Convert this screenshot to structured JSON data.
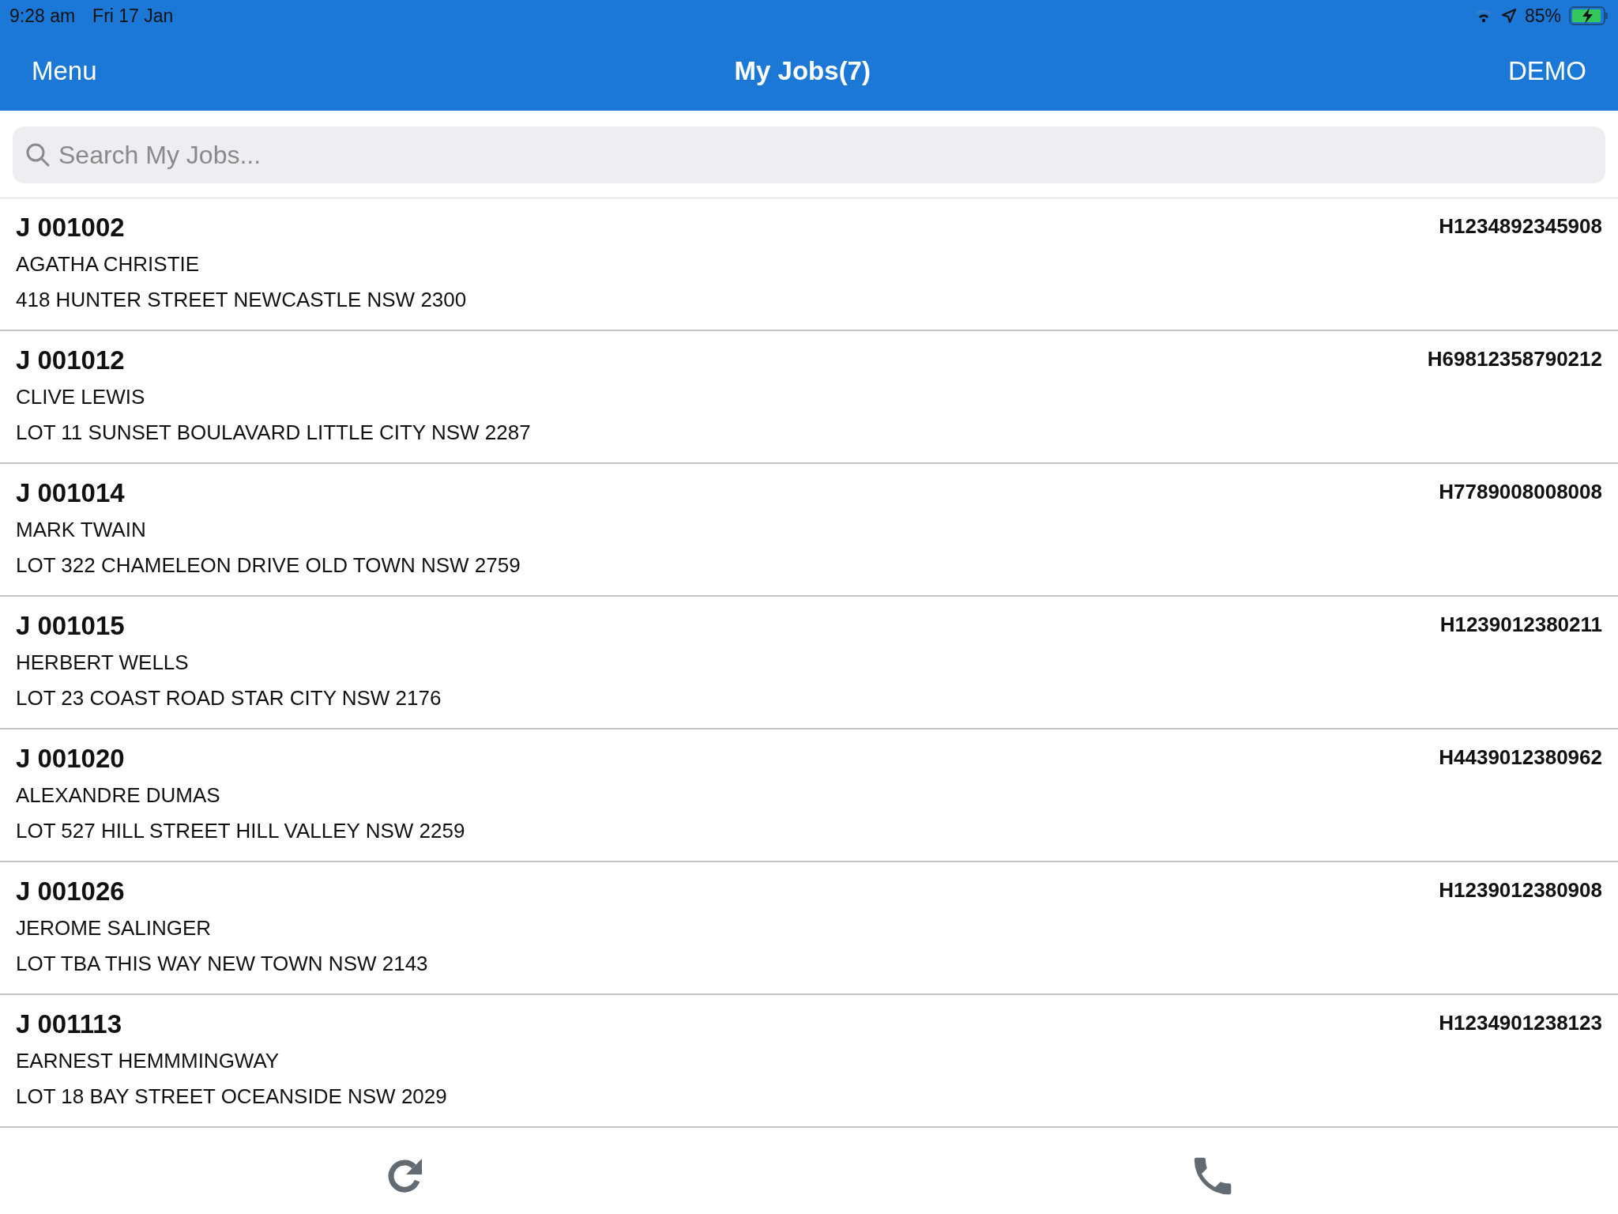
{
  "status_bar": {
    "time": "9:28 am",
    "date": "Fri 17 Jan",
    "battery": "85%"
  },
  "header": {
    "menu": "Menu",
    "title": "My Jobs(7)",
    "account": "DEMO"
  },
  "search": {
    "placeholder": "Search My Jobs..."
  },
  "jobs": [
    {
      "number": "J 001002",
      "code": "H1234892345908",
      "name": "AGATHA CHRISTIE",
      "address": "418 HUNTER STREET NEWCASTLE NSW 2300"
    },
    {
      "number": "J 001012",
      "code": "H69812358790212",
      "name": "CLIVE LEWIS",
      "address": "LOT 11 SUNSET BOULAVARD LITTLE CITY NSW 2287"
    },
    {
      "number": "J 001014",
      "code": "H7789008008008",
      "name": "MARK TWAIN",
      "address": "LOT 322 CHAMELEON DRIVE OLD TOWN NSW 2759"
    },
    {
      "number": "J 001015",
      "code": "H1239012380211",
      "name": "HERBERT WELLS",
      "address": "LOT 23 COAST ROAD STAR CITY NSW 2176"
    },
    {
      "number": "J 001020",
      "code": "H4439012380962",
      "name": "ALEXANDRE DUMAS",
      "address": "LOT 527 HILL STREET HILL VALLEY NSW 2259"
    },
    {
      "number": "J 001026",
      "code": "H1239012380908",
      "name": "JEROME SALINGER",
      "address": "LOT TBA THIS WAY NEW TOWN NSW 2143"
    },
    {
      "number": "J 001113",
      "code": "H1234901238123",
      "name": "EARNEST HEMMMINGWAY",
      "address": "LOT 18 BAY STREET OCEANSIDE NSW 2029"
    }
  ]
}
